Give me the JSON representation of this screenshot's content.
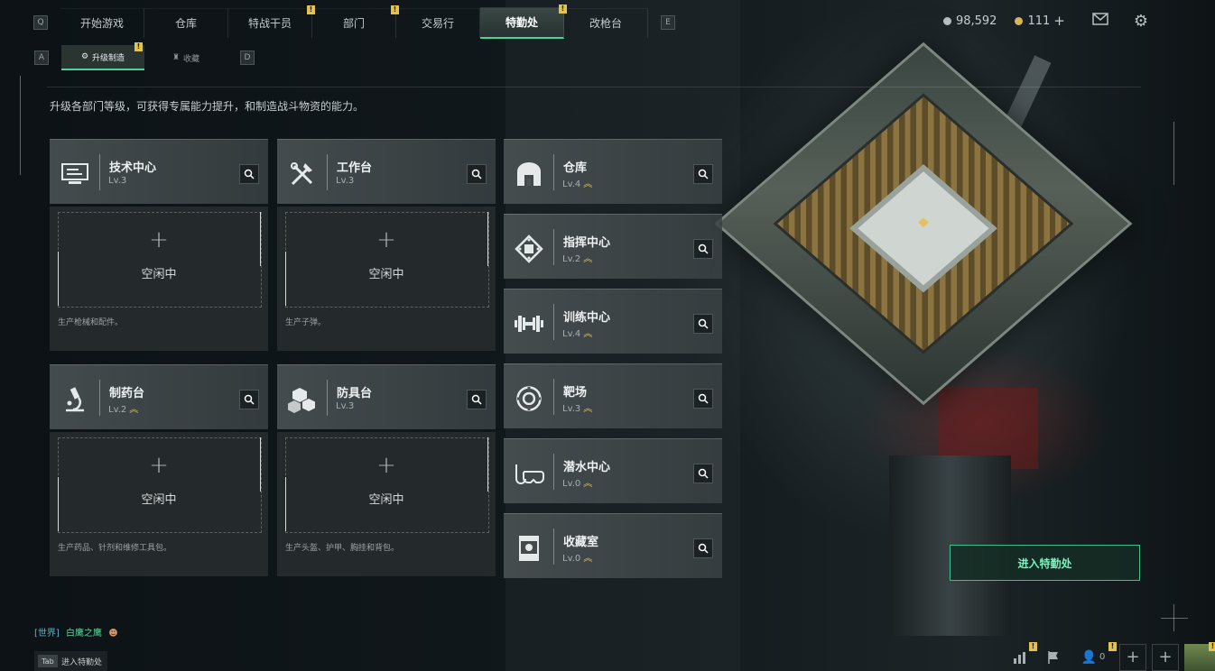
{
  "nav": {
    "left_hint": "Q",
    "right_hint": "E",
    "tabs": [
      {
        "label": "开始游戏",
        "active": false,
        "badge": ""
      },
      {
        "label": "仓库",
        "active": false,
        "badge": ""
      },
      {
        "label": "特战干员",
        "active": false,
        "badge": "!"
      },
      {
        "label": "部门",
        "active": false,
        "badge": "!"
      },
      {
        "label": "交易行",
        "active": false,
        "badge": ""
      },
      {
        "label": "特勤处",
        "active": true,
        "badge": "!"
      },
      {
        "label": "改枪台",
        "active": false,
        "badge": ""
      }
    ]
  },
  "subnav": {
    "left_hint": "A",
    "right_hint": "D",
    "tabs": [
      {
        "label": "升级制造",
        "active": true,
        "badge": "!"
      },
      {
        "label": "收藏",
        "active": false,
        "badge": ""
      }
    ]
  },
  "currency": {
    "silver": "98,592",
    "gold": "111",
    "add": "+"
  },
  "intro": "升级各部门等级，可获得专属能力提升，和制造战斗物资的能力。",
  "production": [
    {
      "name": "技术中心",
      "level": "Lv.3",
      "upgradable": false,
      "idle_label": "空闲中",
      "desc": "生产枪械和配件。"
    },
    {
      "name": "工作台",
      "level": "Lv.3",
      "upgradable": false,
      "idle_label": "空闲中",
      "desc": "生产子弹。"
    },
    {
      "name": "制药台",
      "level": "Lv.2",
      "upgradable": true,
      "idle_label": "空闲中",
      "desc": "生产药品、针剂和维修工具包。"
    },
    {
      "name": "防具台",
      "level": "Lv.3",
      "upgradable": false,
      "idle_label": "空闲中",
      "desc": "生产头盔、护甲、胸挂和背包。"
    }
  ],
  "departments": [
    {
      "name": "仓库",
      "level": "Lv.4",
      "upgradable": true
    },
    {
      "name": "指挥中心",
      "level": "Lv.2",
      "upgradable": true
    },
    {
      "name": "训练中心",
      "level": "Lv.4",
      "upgradable": true
    },
    {
      "name": "靶场",
      "level": "Lv.3",
      "upgradable": true
    },
    {
      "name": "潜水中心",
      "level": "Lv.0",
      "upgradable": true
    },
    {
      "name": "收藏室",
      "level": "Lv.0",
      "upgradable": true
    }
  ],
  "enter_button": "进入特勤处",
  "chat": {
    "channel": "[世界]",
    "name": "白鹰之鹰"
  },
  "tab_hint": {
    "key": "Tab",
    "label": "进入特勤处"
  },
  "bottom": {
    "friends": "0"
  }
}
